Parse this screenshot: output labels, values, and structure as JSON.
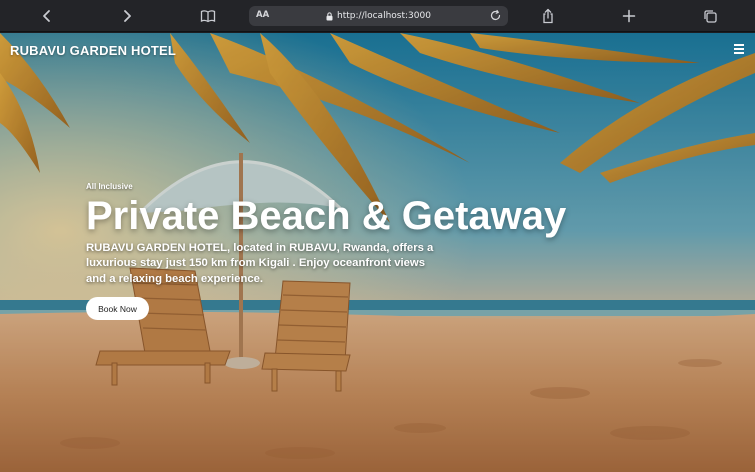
{
  "browser": {
    "url": "http://localhost:3000",
    "text_size_label": "AA",
    "icons": [
      "back-arrow-icon",
      "forward-arrow-icon",
      "book-icon",
      "lock-icon",
      "reload-icon",
      "share-icon",
      "plus-icon",
      "tabs-icon"
    ]
  },
  "site": {
    "brand": "RUBAVU GARDEN HOTEL",
    "menu_icon": "hamburger-menu-icon"
  },
  "hero": {
    "eyebrow": "All Inclusive",
    "title": "Private Beach & Getaway",
    "description": "RUBAVU GARDEN HOTEL, located in RUBAVU, Rwanda, offers a luxurious stay just 150 km from Kigali . Enjoy oceanfront views and a relaxing beach experience.",
    "cta_label": "Book Now"
  },
  "colors": {
    "chrome_bg": "#232428",
    "url_bar_bg": "#3a3b40",
    "hero_text": "#ffffff",
    "cta_bg": "#ffffff"
  }
}
